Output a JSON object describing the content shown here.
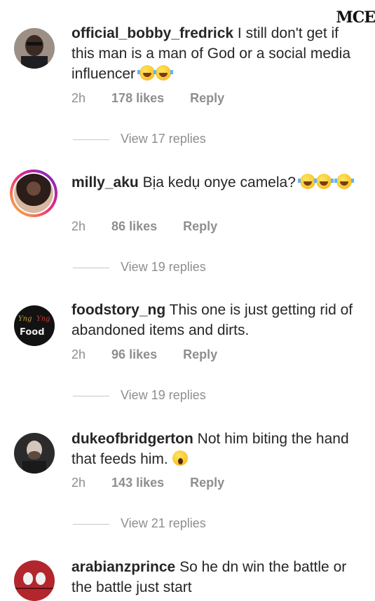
{
  "watermark": "MCE",
  "comments": [
    {
      "username": "official_bobby_fredrick",
      "text": "I still don't get if this man is a man of God or a social media influencer",
      "emoji": [
        "face-with-tears-of-joy",
        "face-with-tears-of-joy"
      ],
      "time": "2h",
      "likes": "178 likes",
      "reply": "Reply",
      "view_replies": "View 17 replies"
    },
    {
      "username": "milly_aku",
      "text": "Bịa kedụ onye camela?",
      "emoji": [
        "face-with-tears-of-joy",
        "face-with-tears-of-joy",
        "face-with-tears-of-joy"
      ],
      "time": "2h",
      "likes": "86 likes",
      "reply": "Reply",
      "view_replies": "View 19 replies"
    },
    {
      "username": "foodstory_ng",
      "text": "This one is just getting rid of abandoned items and dirts.",
      "time": "2h",
      "likes": "96 likes",
      "reply": "Reply",
      "view_replies": "View 19 replies"
    },
    {
      "username": "dukeofbridgerton",
      "text": "Not him biting the hand that feeds him.",
      "emoji": [
        "face-with-open-mouth"
      ],
      "time": "2h",
      "likes": "143 likes",
      "reply": "Reply",
      "view_replies": "View 21 replies"
    },
    {
      "username": "arabianzprince",
      "text": "So he dn win the battle or  the battle just start"
    }
  ]
}
